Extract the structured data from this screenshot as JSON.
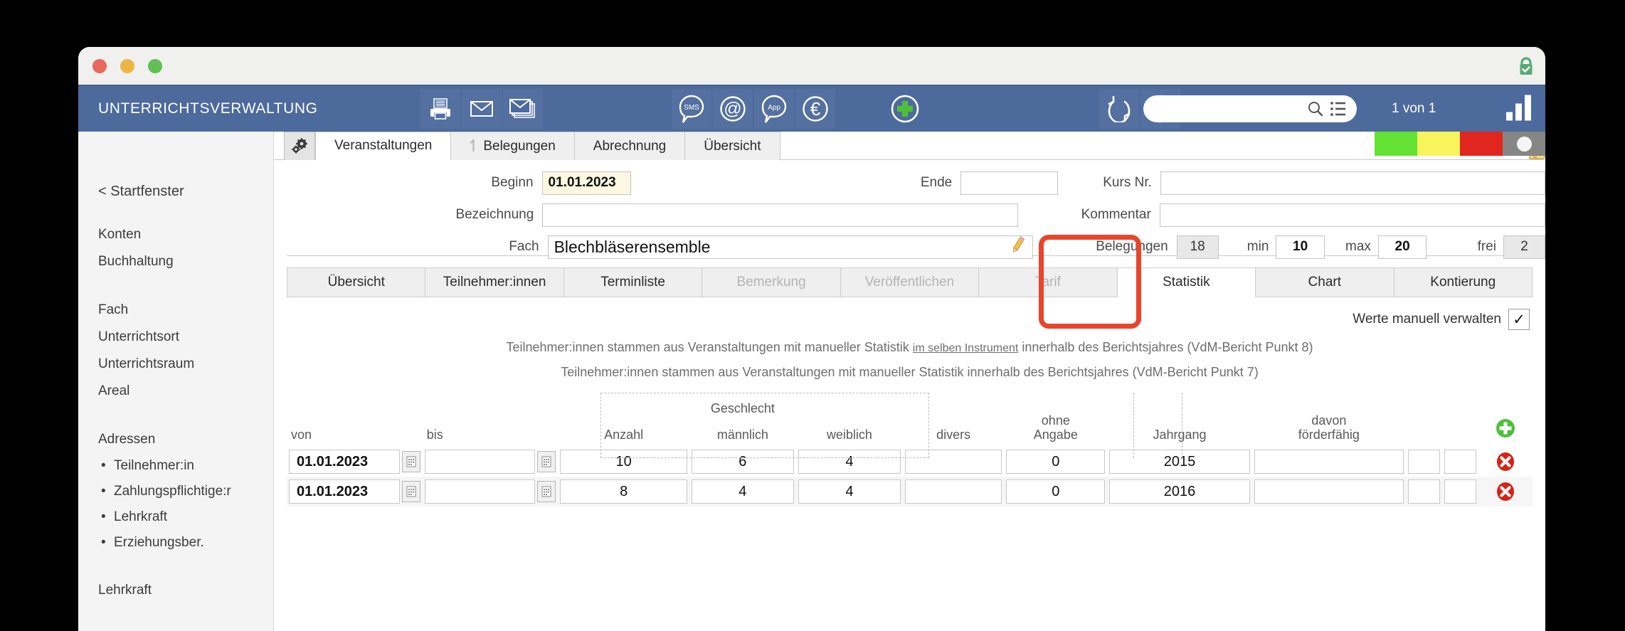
{
  "window": {
    "traffic_lights": [
      "close",
      "minimize",
      "zoom"
    ],
    "lock_icon": "lock-secure-icon"
  },
  "appbar": {
    "title": "UNTERRICHTSVERWALTUNG",
    "icons_left": [
      {
        "name": "printer-icon",
        "glyph": "printer"
      },
      {
        "name": "mail-icon",
        "glyph": "envelope"
      },
      {
        "name": "mail-batch-icon",
        "glyph": "envelopes"
      }
    ],
    "icons_mid": [
      {
        "name": "sms-icon",
        "label": "SMS"
      },
      {
        "name": "email-at-icon",
        "label": "@"
      },
      {
        "name": "app-icon",
        "label": "App"
      },
      {
        "name": "euro-icon",
        "label": "€"
      }
    ],
    "icons_add": [
      {
        "name": "add-plus-icon",
        "label": "+"
      }
    ],
    "icons_right": [
      {
        "name": "refresh-icon",
        "glyph": "circular-arrow"
      },
      {
        "name": "search-person-icon",
        "glyph": "magnifier-person"
      }
    ],
    "search": {
      "value": "",
      "placeholder": "",
      "icon": "search-icon",
      "list_icon": "list-icon"
    },
    "record_count": "1 von 1",
    "chart_icon": "bar-chart-icon"
  },
  "sidebar": {
    "back_link": "< Startfenster",
    "groups": [
      {
        "items": [
          "Konten",
          "Buchhaltung"
        ]
      },
      {
        "items": [
          "Fach",
          "Unterrichtsort",
          "Unterrichtsraum",
          "Areal"
        ]
      },
      {
        "header": "Adressen",
        "sub": [
          "Teilnehmer:in",
          "Zahlungspflichtige:r",
          "Lehrkraft",
          "Erziehungsber."
        ]
      },
      {
        "items": [
          "Lehrkraft"
        ]
      }
    ]
  },
  "top_tabs": {
    "gear_icon": "gears-icon",
    "items": [
      {
        "label": "Veranstaltungen",
        "active": true,
        "icon": null
      },
      {
        "label": "Belegungen",
        "active": false,
        "icon": "arrow-up-icon"
      },
      {
        "label": "Abrechnung",
        "active": false,
        "icon": null
      },
      {
        "label": "Übersicht",
        "active": false,
        "icon": null
      }
    ],
    "eye_icon": "eye-icon",
    "edit_note_icon": "note-pencil-icon",
    "status_colors": [
      "#63e234",
      "#f8f45c",
      "#e0261e",
      "#868686"
    ]
  },
  "form": {
    "left": [
      {
        "label": "Beginn",
        "value": "01.01.2023",
        "style": "cream"
      },
      {
        "label": "Bezeichnung",
        "value": "",
        "style": "plain"
      },
      {
        "label": "Fach",
        "value": "Blechbläserensemble",
        "style": "plain",
        "icon": "pencil-icon"
      }
    ],
    "ende": {
      "label": "Ende",
      "value": ""
    },
    "right": [
      {
        "label": "Kurs Nr.",
        "value": ""
      },
      {
        "label": "Kommentar",
        "value": ""
      }
    ],
    "belegungen": {
      "label": "Belegungen",
      "total": "18",
      "min_label": "min",
      "min": "10",
      "max_label": "max",
      "max": "20",
      "frei_label": "frei",
      "frei": "2"
    }
  },
  "sub_tabs": {
    "items": [
      {
        "label": "Übersicht",
        "state": "normal"
      },
      {
        "label": "Teilnehmer:innen",
        "state": "normal"
      },
      {
        "label": "Terminliste",
        "state": "normal"
      },
      {
        "label": "Bemerkung",
        "state": "disabled"
      },
      {
        "label": "Veröffentlichen",
        "state": "disabled"
      },
      {
        "label": "Tarif",
        "state": "disabled"
      },
      {
        "label": "Statistik",
        "state": "active"
      },
      {
        "label": "Chart",
        "state": "normal"
      },
      {
        "label": "Kontierung",
        "state": "normal"
      }
    ],
    "highlight_index": 6,
    "highlight_color": "#e8452c"
  },
  "manual": {
    "label": "Werte manuell verwalten",
    "checked": "✓"
  },
  "notes": [
    {
      "pre": "Teilnehmer:innen stammen aus Veranstaltungen mit manueller Statistik ",
      "underlined": "im selben Instrument",
      "post": " innerhalb des Berichtsjahres (VdM-Bericht Punkt 8)"
    },
    {
      "pre": "Teilnehmer:innen stammen aus Veranstaltungen mit manueller Statistik innerhalb des Berichtsjahres (VdM-Bericht Punkt 7)",
      "underlined": "",
      "post": ""
    }
  ],
  "table": {
    "group_header": "Geschlecht",
    "columns": [
      {
        "key": "von",
        "label": "von"
      },
      {
        "key": "bis",
        "label": "bis"
      },
      {
        "key": "anzahl",
        "label": "Anzahl"
      },
      {
        "key": "maennlich",
        "label": "männlich"
      },
      {
        "key": "weiblich",
        "label": "weiblich"
      },
      {
        "key": "divers",
        "label": "divers"
      },
      {
        "key": "ohne",
        "label": "ohne\nAngabe"
      },
      {
        "key": "jahrgang",
        "label": "Jahrgang"
      },
      {
        "key": "foerder",
        "label": "davon\nförderfähig"
      },
      {
        "key": "x1",
        "label": ""
      },
      {
        "key": "x2",
        "label": ""
      },
      {
        "key": "actions",
        "label": ""
      }
    ],
    "add_icon": "add-row-icon",
    "rows": [
      {
        "von": "01.01.2023",
        "bis": "",
        "anzahl": "10",
        "maennlich": "6",
        "weiblich": "4",
        "divers": "",
        "ohne": "0",
        "jahrgang": "2015",
        "foerder": "",
        "x1": "",
        "x2": "",
        "delete_icon": "delete-row-icon"
      },
      {
        "von": "01.01.2023",
        "bis": "",
        "anzahl": "8",
        "maennlich": "4",
        "weiblich": "4",
        "divers": "",
        "ohne": "0",
        "jahrgang": "2016",
        "foerder": "",
        "x1": "",
        "x2": "",
        "delete_icon": "delete-row-icon"
      }
    ]
  }
}
